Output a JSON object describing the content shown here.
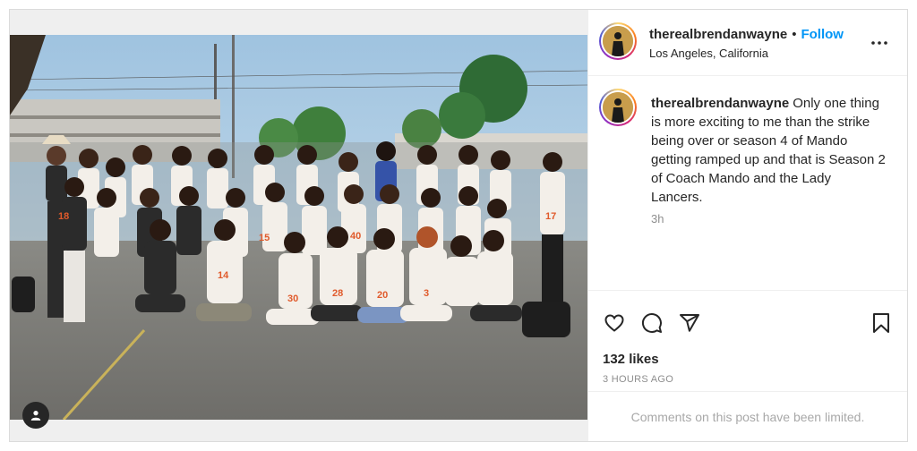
{
  "post": {
    "author": {
      "username": "therealbrendanwayne",
      "location": "Los Angeles, California"
    },
    "follow_label": "Follow",
    "separator": "•",
    "icons": {
      "more": "more-options-icon",
      "like": "heart-icon",
      "comment": "comment-icon",
      "share": "share-icon",
      "save": "bookmark-icon",
      "user_tag": "user-tag-icon"
    },
    "caption": {
      "username": "therealbrendanwayne",
      "text": "Only one thing is more exciting to me than the strike being over or season 4 of Mando getting ramped up and that is Season 2 of Coach Mando and the Lady Lancers."
    },
    "caption_time": "3h",
    "likes": "132 likes",
    "posted": "3 HOURS AGO",
    "comments_notice": "Comments on this post have been limited.",
    "colors": {
      "link_blue": "#0095f6",
      "muted_text": "#8e8e8e",
      "border": "#dbdbdb",
      "jersey_white": "#ffffff",
      "jersey_number": "#e05a2b"
    }
  }
}
